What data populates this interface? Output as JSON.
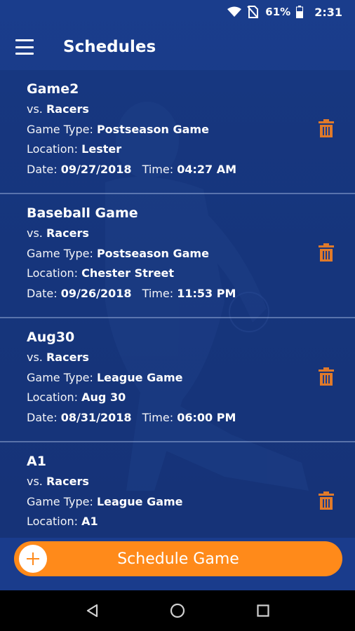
{
  "status_bar": {
    "battery": "61%",
    "time": "2:31",
    "icons": [
      "wifi-icon",
      "no-sim-icon",
      "battery-icon"
    ]
  },
  "app_bar": {
    "title": "Schedules",
    "menu_icon": "hamburger-menu-icon"
  },
  "schedules": [
    {
      "title": "Game2",
      "vs_label": "vs.",
      "opponent": "Racers",
      "game_type_label": "Game Type:",
      "game_type": "Postseason Game",
      "location_label": "Location:",
      "location": "Lester",
      "date_label": "Date:",
      "date": "09/27/2018",
      "time_label": "Time:",
      "time": "04:27 AM"
    },
    {
      "title": "Baseball Game",
      "vs_label": "vs.",
      "opponent": "Racers",
      "game_type_label": "Game Type:",
      "game_type": "Postseason Game",
      "location_label": "Location:",
      "location": "Chester Street",
      "date_label": "Date:",
      "date": "09/26/2018",
      "time_label": "Time:",
      "time": "11:53 PM"
    },
    {
      "title": "Aug30",
      "vs_label": "vs.",
      "opponent": "Racers",
      "game_type_label": "Game Type:",
      "game_type": "League Game",
      "location_label": "Location:",
      "location": "Aug 30",
      "date_label": "Date:",
      "date": "08/31/2018",
      "time_label": "Time:",
      "time": "06:00 PM"
    },
    {
      "title": "A1",
      "vs_label": "vs.",
      "opponent": "Racers",
      "game_type_label": "Game Type:",
      "game_type": "League Game",
      "location_label": "Location:",
      "location": "A1"
    }
  ],
  "schedule_button": {
    "label": "Schedule Game",
    "icon": "plus-icon"
  },
  "nav_bar": {
    "icons": [
      "back-icon",
      "home-icon",
      "recents-icon"
    ]
  },
  "colors": {
    "background": "#183a85",
    "accent": "#ff8a1a",
    "trash": "#e07a2a",
    "text": "#ffffff"
  }
}
